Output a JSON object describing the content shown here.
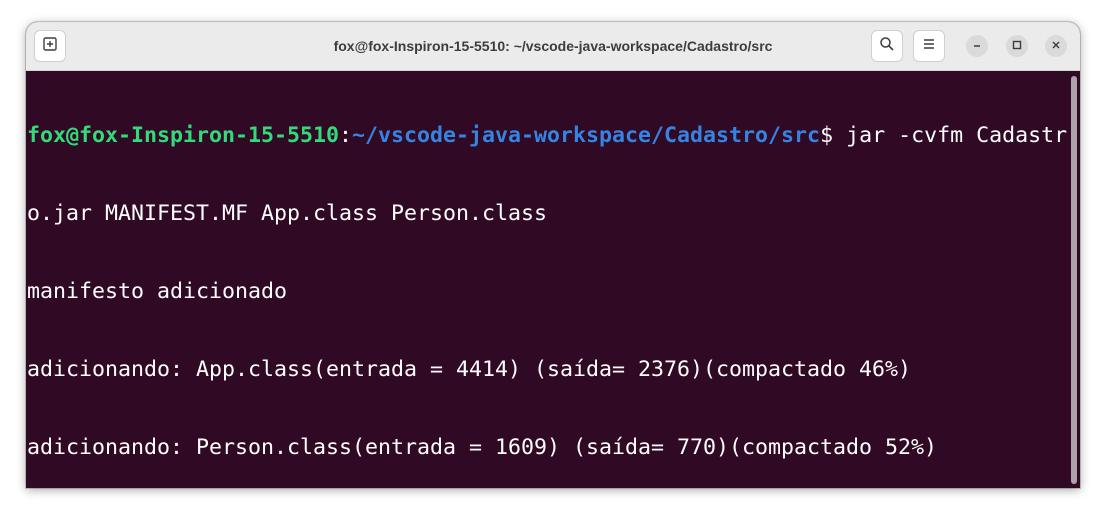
{
  "window": {
    "title": "fox@fox-Inspiron-15-5510: ~/vscode-java-workspace/Cadastro/src"
  },
  "header_buttons": {
    "new_tab_icon": "new-tab-icon",
    "search_icon": "search-icon",
    "menu_icon": "hamburger-menu-icon",
    "minimize_icon": "minimize-icon",
    "maximize_icon": "maximize-icon",
    "close_icon": "close-icon"
  },
  "terminal": {
    "prompt_user": "fox@fox-Inspiron-15-5510",
    "prompt_colon": ":",
    "prompt_path": "~/vscode-java-workspace/Cadastro/src",
    "prompt_dollar": "$",
    "command_part1": " jar -cvfm Cadastr",
    "command_part2": "o.jar MANIFEST.MF App.class Person.class",
    "output": [
      "manifesto adicionado",
      "adicionando: App.class(entrada = 4414) (saída= 2376)(compactado 46%)",
      "adicionando: Person.class(entrada = 1609) (saída= 770)(compactado 52%)"
    ],
    "final_prompt_trailing": ""
  },
  "colors": {
    "terminal_background": "#300a24",
    "prompt_user_color": "#33da7a",
    "prompt_path_color": "#3584e4",
    "text_color": "#ffffff",
    "titlebar_background": "#ebebeb"
  }
}
